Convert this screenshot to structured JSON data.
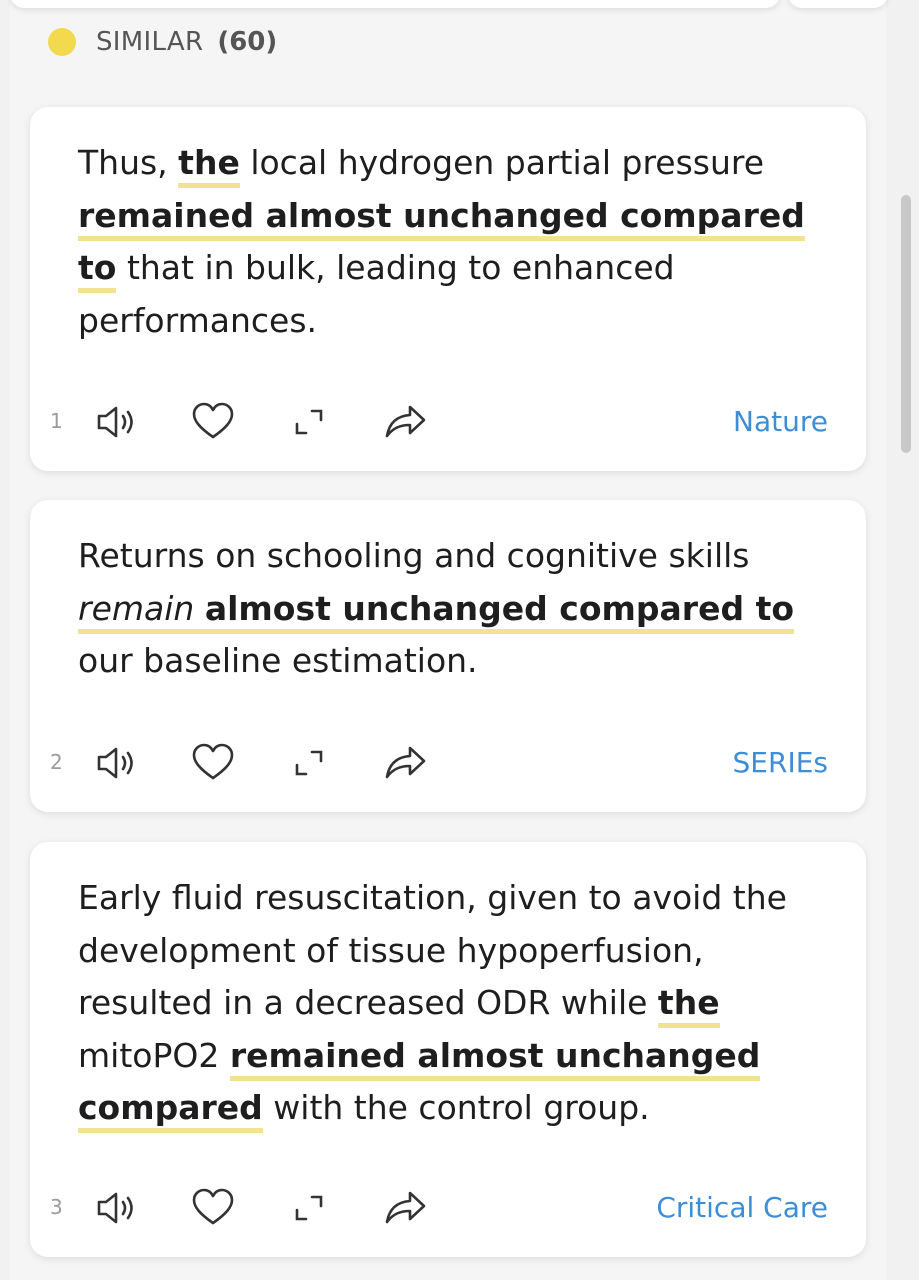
{
  "header": {
    "label": "SIMILAR",
    "count": "(60)"
  },
  "colors": {
    "accent_dot": "#f2d94e",
    "highlight": "#f2e392",
    "source_link": "#3d8ed6"
  },
  "icons": [
    "speaker-icon",
    "heart-icon",
    "expand-icon",
    "share-icon"
  ],
  "cards": [
    {
      "number": "1",
      "parts": [
        "Thus, ",
        "the",
        " local hydrogen partial pressure ",
        "remained almost unchanged compared to",
        " that in bulk, leading to enhanced performances."
      ],
      "source": "Nature"
    },
    {
      "number": "2",
      "parts": [
        "Returns on schooling and cognitive skills ",
        "remain",
        " ",
        "almost unchanged compared to",
        " our baseline estimation."
      ],
      "source": "SERIEs"
    },
    {
      "number": "3",
      "parts": [
        "Early fluid resuscitation, given to avoid the development of tissue hypoperfusion, resulted in a decreased ODR while ",
        "the",
        " mitoPO2 ",
        "remained almost unchanged compared",
        " with the control group."
      ],
      "source": "Critical Care"
    }
  ]
}
